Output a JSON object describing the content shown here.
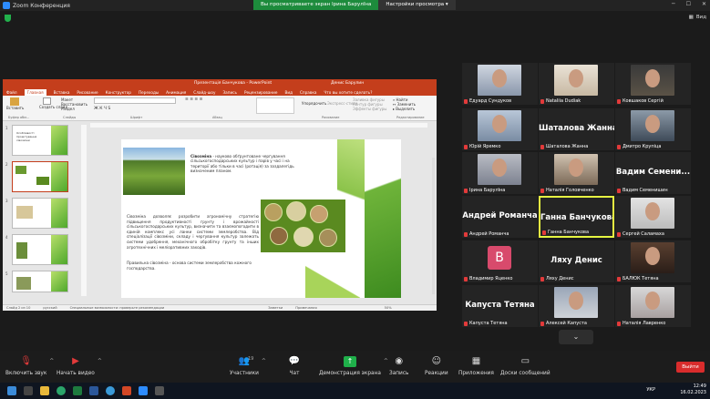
{
  "zoom": {
    "window_title": "Zoom Конференция",
    "share_banner": "Вы просматриваете экран Ірина Барулїна",
    "view_settings": "Настройки просмотра",
    "view_label": "Вид",
    "end_label": "Выйти"
  },
  "ppt": {
    "title": "Презентація Банчукова - PowerPoint",
    "user": "Денис Барулин",
    "menu": [
      "Файл",
      "Главная",
      "Вставка",
      "Рисование",
      "Конструктор",
      "Переходы",
      "Анимация",
      "Слайд-шоу",
      "Запись",
      "Рецензирование",
      "Вид",
      "Справка",
      "Что вы хотите сделать?"
    ],
    "ribbon": {
      "paste": "Вставить",
      "clipboard": "Буфер обм...",
      "new_slide": "Создать слайд",
      "layout": "Макет",
      "reset": "Восстановить",
      "section": "Раздел",
      "slides": "Слайды",
      "font": "Шрифт",
      "paragraph": "Абзац",
      "arrange": "Упорядочить",
      "quick_styles": "Экспресс-стили",
      "fill": "Заливка фигуры",
      "outline": "Контур фигуры",
      "effects": "Эффекты фигуры",
      "drawing": "Рисование",
      "find": "Найти",
      "replace": "Заменить",
      "select": "Выделить",
      "editing": "Редактирование"
    },
    "thumbs": [
      {
        "n": "1",
        "title": "Особливості проектування сівозміни"
      },
      {
        "n": "2",
        "title": ""
      },
      {
        "n": "3",
        "title": ""
      },
      {
        "n": "4",
        "title": ""
      },
      {
        "n": "5",
        "title": ""
      }
    ],
    "slide": {
      "t1_bold": "Сівозміна",
      "t1": " - науково обґрунтоване чергування сільськогосподарських культур і парів у часі і на території або тільки в часі  (ротація) за заздалегідь визначеним планом.",
      "t2": "Сівозміна дозволяє розробити агрономічну стратегію підвищення продуктивності грунту і врожайності сільськогосподарських культур, визначити та взаємопогодити в єдиній комплекс усі ланки системи землеробства. Від спеціалізації сівозміни, складу і чергування культур залежать системи удобрення, механічного обробітку грунту та інших агротехнічних і меліоративних заходів.",
      "t3": "Правильна сівозміна - основа системи землеробства кожного господарства."
    },
    "status": {
      "slide": "Слайд 2 из 10",
      "lang": "русский",
      "access": "Специальные возможности: проверьте рекомендации",
      "notes": "Заметки",
      "comments": "Примечания",
      "zoom": "50%"
    }
  },
  "participants": [
    {
      "name": "Едуард Сундуков",
      "big": "",
      "type": "video"
    },
    {
      "name": "Nataliia Dudiak",
      "big": "",
      "type": "video"
    },
    {
      "name": "Ковшаков Сергій",
      "big": "",
      "type": "video"
    },
    {
      "name": "Юрій Яремко",
      "big": "",
      "type": "video"
    },
    {
      "name": "Шаталова Жанна",
      "big": "Шаталова Жанна",
      "type": "name"
    },
    {
      "name": "Дмитро Крупіца",
      "big": "",
      "type": "video"
    },
    {
      "name": "Ірина Барулїна",
      "big": "",
      "type": "video"
    },
    {
      "name": "Наталія Головченко",
      "big": "",
      "type": "video"
    },
    {
      "name": "Вадим Семенишин",
      "big": "Вадим  Семени...",
      "type": "name"
    },
    {
      "name": "Андрей Романча",
      "big": "Андрей Романча",
      "type": "name"
    },
    {
      "name": "Ганна Банчукова",
      "big": "Ганна Банчукова",
      "type": "name"
    },
    {
      "name": "Сергей Саламаха",
      "big": "",
      "type": "video"
    },
    {
      "name": "Владимир Яценко",
      "big": "B",
      "type": "avatar"
    },
    {
      "name": "Ляху Денис",
      "big": "Ляху Денис",
      "type": "name"
    },
    {
      "name": "БАЛЮК Тетяна",
      "big": "",
      "type": "video"
    },
    {
      "name": "Капуста Тетяна",
      "big": "Капуста Тетяна",
      "type": "name"
    },
    {
      "name": "Алексей Капуста",
      "big": "",
      "type": "video"
    },
    {
      "name": "Наталія Лавренко",
      "big": "",
      "type": "video"
    }
  ],
  "toolbar": {
    "unmute": "Включить звук",
    "video": "Начать видео",
    "participants": "Участники",
    "participants_count": "19",
    "chat": "Чат",
    "share": "Демонстрация экрана",
    "record": "Запись",
    "reactions": "Реакции",
    "apps": "Приложения",
    "whiteboard": "Доски сообщений"
  },
  "taskbar": {
    "lang": "УКР",
    "time": "12:49",
    "date": "16.02.2023"
  },
  "colors": {
    "ppt_red": "#c43e1c",
    "share_green": "#1d8b3c",
    "end_red": "#d92c2c",
    "highlight": "#e6f542"
  }
}
